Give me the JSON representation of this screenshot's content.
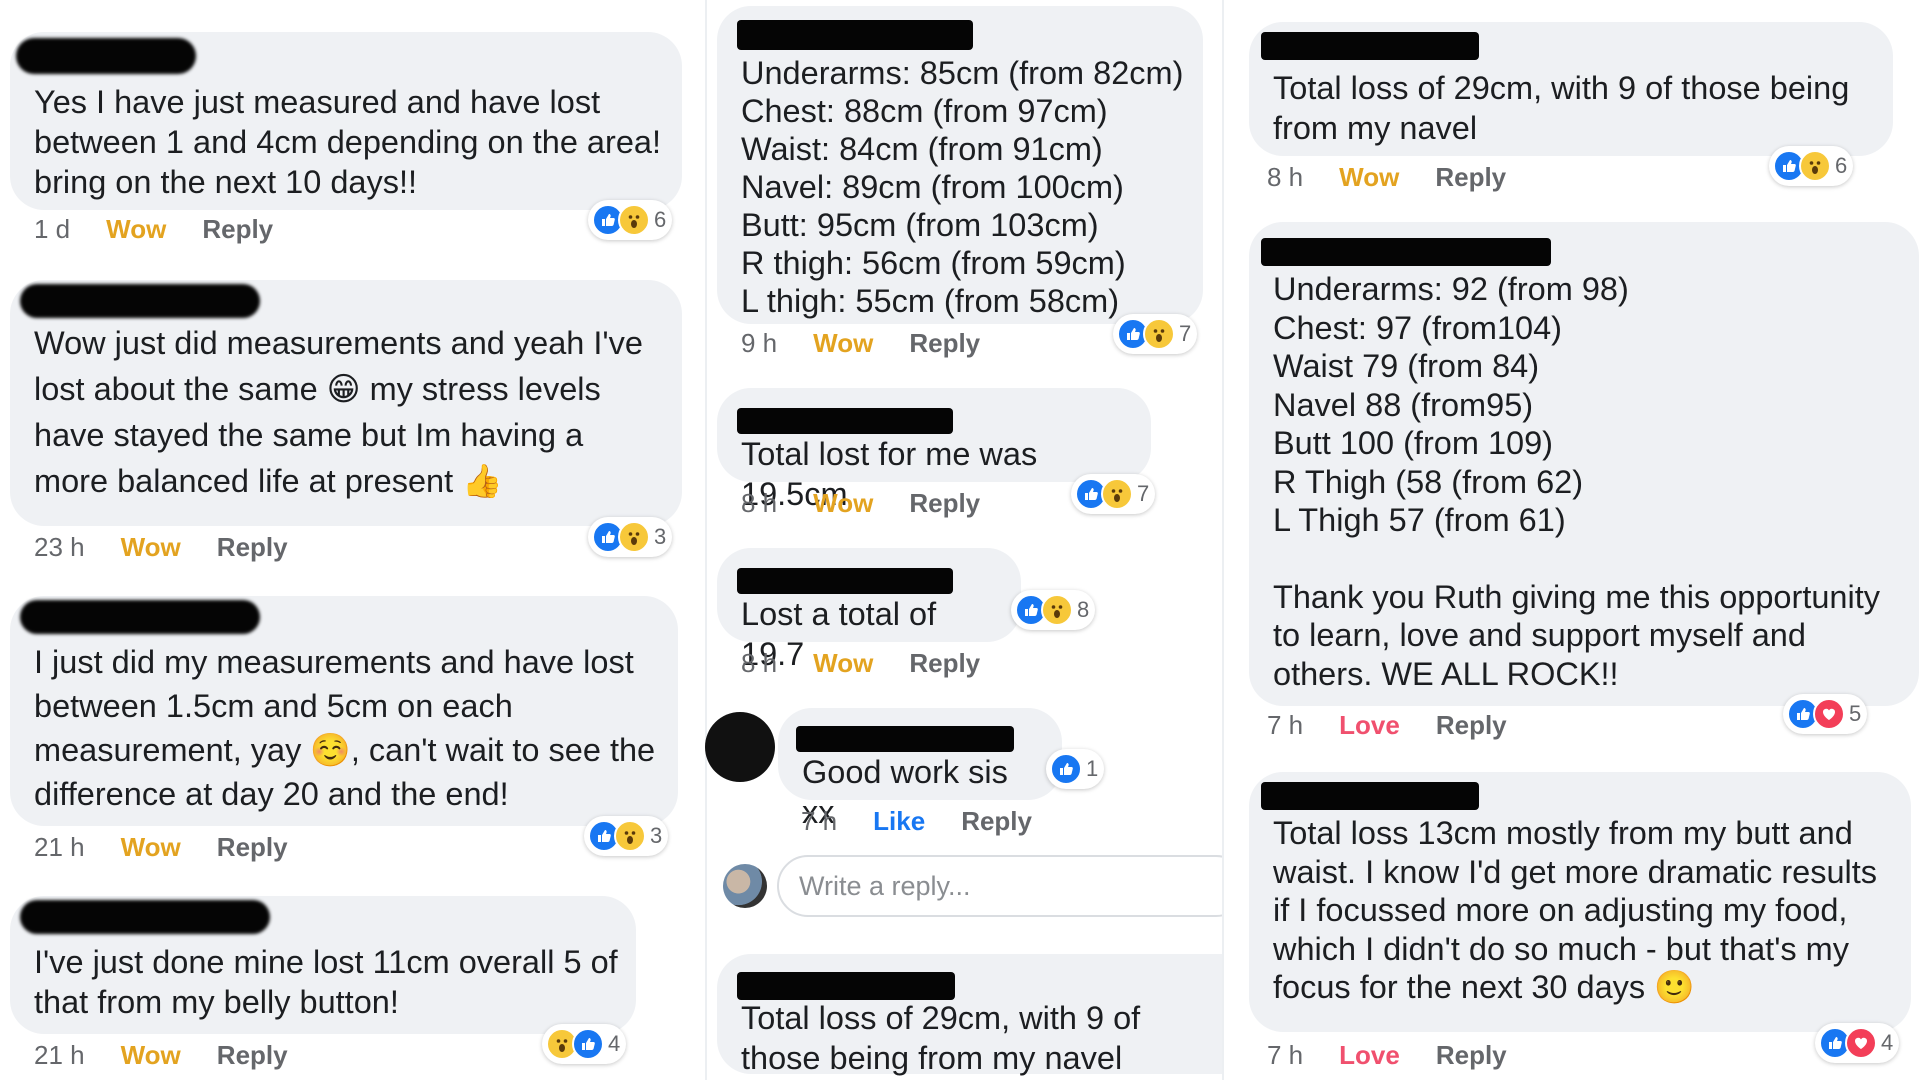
{
  "col1": {
    "comments": [
      {
        "text": "Yes I have just measured and have lost between 1 and 4cm depending on the area! bring on the next 10 days!!",
        "time": "1 d",
        "action1": "Wow",
        "reply": "Reply",
        "count": "6"
      },
      {
        "text": "Wow just did measurements and yeah I've lost about the same 😁 my stress levels have stayed the same but Im having a more balanced life at present 👍",
        "time": "23 h",
        "action1": "Wow",
        "reply": "Reply",
        "count": "3"
      },
      {
        "text": "I just did my measurements and have lost between 1.5cm and 5cm on each measurement, yay ☺️, can't wait to see the difference at day 20 and the end!",
        "time": "21 h",
        "action1": "Wow",
        "reply": "Reply",
        "count": "3"
      },
      {
        "text": "I've just done mine lost 11cm overall 5 of that from my belly button!",
        "time": "21 h",
        "action1": "Wow",
        "reply": "Reply",
        "count": "4"
      }
    ]
  },
  "col2": {
    "comments": [
      {
        "lines": [
          "Underarms: 85cm (from 82cm)",
          "Chest: 88cm (from 97cm)",
          "Waist: 84cm (from 91cm)",
          "Navel: 89cm (from 100cm)",
          "Butt: 95cm (from 103cm)",
          "R thigh: 56cm (from 59cm)",
          "L thigh: 55cm (from 58cm)"
        ],
        "time": "9 h",
        "action1": "Wow",
        "reply": "Reply",
        "count": "7"
      },
      {
        "text": "Total lost for me was 19.5cm",
        "time": "8 h",
        "action1": "Wow",
        "reply": "Reply",
        "count": "7"
      },
      {
        "text": "Lost a total of 19.7",
        "time": "8 h",
        "action1": "Wow",
        "reply": "Reply",
        "count": "8"
      },
      {
        "text": "Good work sis xx",
        "time": "7 h",
        "action1": "Like",
        "reply": "Reply",
        "count": "1"
      },
      {
        "text": "Total loss of 29cm, with 9 of those being from my navel"
      }
    ],
    "reply_placeholder": "Write a reply..."
  },
  "col3": {
    "comments": [
      {
        "text": "Total loss of 29cm, with 9 of those being from my navel",
        "time": "8 h",
        "action1": "Wow",
        "reply": "Reply",
        "count": "6"
      },
      {
        "lines": [
          "Underarms: 92 (from 98)",
          "Chest: 97 (from104)",
          "Waist 79 (from 84)",
          "Navel 88 (from95)",
          "Butt 100 (from 109)",
          "R Thigh (58 (from 62)",
          "L Thigh 57 (from 61)"
        ],
        "closing": "Thank you Ruth giving me this opportunity to learn, love and support myself and others. WE ALL ROCK!!",
        "time": "7 h",
        "action1": "Love",
        "reply": "Reply",
        "count": "5"
      },
      {
        "text": "Total loss 13cm mostly from my butt and waist. I know I'd get more dramatic results if I focussed more on adjusting my food, which I didn't do so much - but that's my focus for the next 30 days 🙂",
        "time": "7 h",
        "action1": "Love",
        "reply": "Reply",
        "count": "4"
      }
    ]
  },
  "colors": {
    "bubble": "#eff1f4",
    "wow": "#e3a320",
    "love": "#f0506e",
    "like": "#1877f2",
    "muted": "#65676b"
  }
}
